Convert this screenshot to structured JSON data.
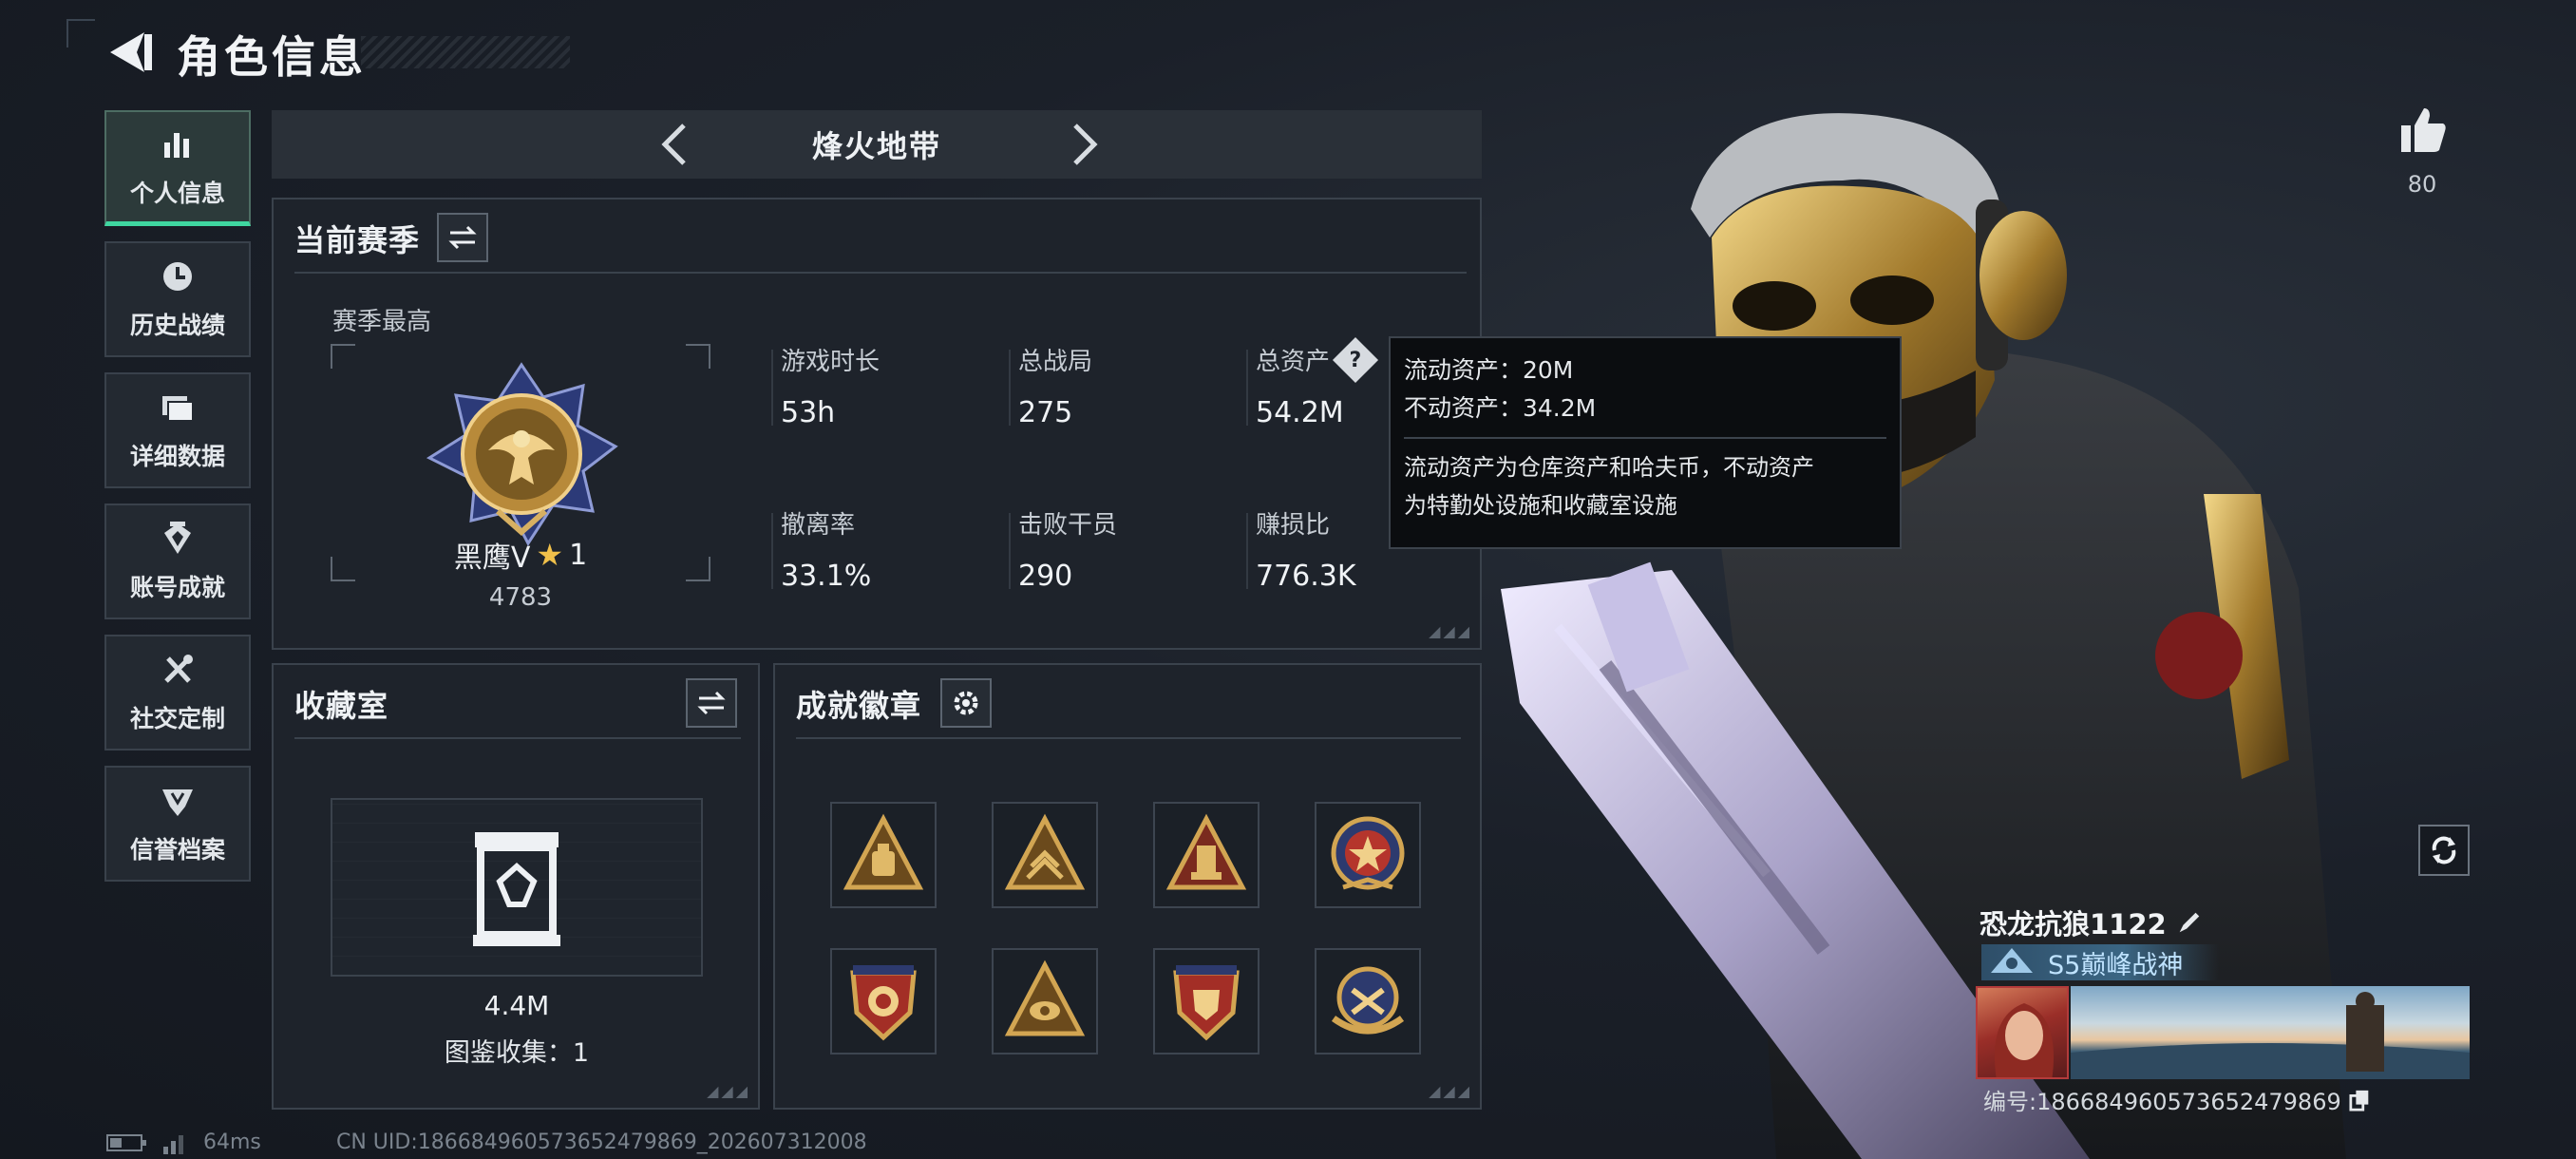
{
  "header": {
    "title": "角色信息",
    "back_icon": "back-arrow-icon"
  },
  "nav": {
    "items": [
      {
        "label": "个人信息",
        "icon": "bar-chart-icon",
        "active": true
      },
      {
        "label": "历史战绩",
        "icon": "clock-icon",
        "active": false
      },
      {
        "label": "详细数据",
        "icon": "folder-icon",
        "active": false
      },
      {
        "label": "账号成就",
        "icon": "achievement-icon",
        "active": false
      },
      {
        "label": "社交定制",
        "icon": "tools-icon",
        "active": false
      },
      {
        "label": "信誉档案",
        "icon": "shield-icon",
        "active": false
      }
    ]
  },
  "mode": {
    "name": "烽火地带"
  },
  "season": {
    "title": "当前赛季",
    "best_label": "赛季最高",
    "rank_name": "黑鹰V",
    "rank_stars": "1",
    "rank_score": "4783",
    "stats": [
      {
        "label": "游戏时长",
        "value": "53h"
      },
      {
        "label": "总战局",
        "value": "275"
      },
      {
        "label": "总资产",
        "value": "54.2M",
        "has_help": true
      },
      {
        "label": "撤离率",
        "value": "33.1%"
      },
      {
        "label": "击败干员",
        "value": "290"
      },
      {
        "label": "赚损比",
        "value": "776.3K"
      }
    ]
  },
  "tooltip": {
    "liquid": "流动资产：20M",
    "fixed": "不动资产：34.2M",
    "note_line1": "流动资产为仓库资产和哈夫币，不动资产",
    "note_line2": "为特勤处设施和收藏室设施"
  },
  "collection": {
    "title": "收藏室",
    "value": "4.4M",
    "count_text": "图鉴收集：1"
  },
  "achievements": {
    "title": "成就徽章",
    "badges": [
      {
        "icon": "triangle-badge-bag-icon"
      },
      {
        "icon": "triangle-badge-chevrons-icon"
      },
      {
        "icon": "triangle-badge-tower-icon"
      },
      {
        "icon": "round-badge-star-icon"
      },
      {
        "icon": "shield-badge-stars-icon"
      },
      {
        "icon": "triangle-badge-eye-icon"
      },
      {
        "icon": "shield-badge-crest-icon"
      },
      {
        "icon": "round-badge-wings-icon"
      }
    ]
  },
  "likes": {
    "count": "80"
  },
  "player": {
    "name": "恐龙抗狼1122",
    "title": "S5巅峰战神",
    "id_text": "编号:186684960573652479869"
  },
  "footer": {
    "ping": "64ms",
    "uid": "CN UID:186684960573652479869_202607312008"
  },
  "colors": {
    "accent": "#3fd6a0",
    "gold": "#c9a052",
    "panel_bg": "#1e232b",
    "tooltip_bg": "#0b0d10"
  }
}
